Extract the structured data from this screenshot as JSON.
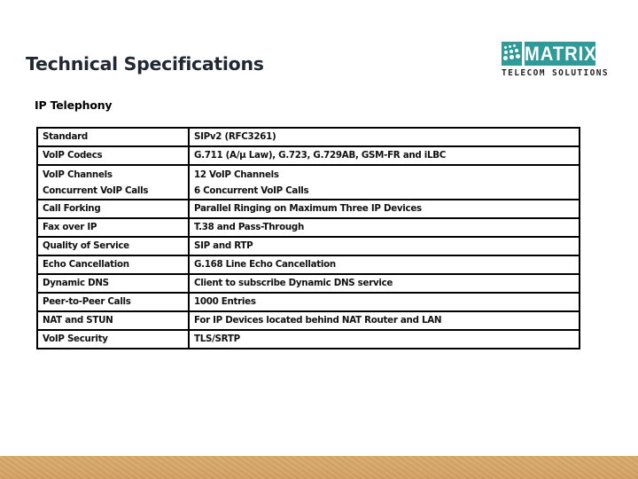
{
  "page": {
    "title": "Technical Specifications",
    "section_title": "IP Telephony"
  },
  "logo": {
    "icon": "matrix-dots-icon",
    "word": "MATRIX",
    "tagline": "TELECOM SOLUTIONS",
    "brand_color": "#2e9a9a"
  },
  "table": {
    "rows": [
      {
        "label": [
          "Standard"
        ],
        "value": [
          "SIPv2 (RFC3261)"
        ]
      },
      {
        "label": [
          "VoIP Codecs"
        ],
        "value": [
          "G.711 (A/µ Law), G.723, G.729AB, GSM-FR and iLBC"
        ]
      },
      {
        "label": [
          "VoIP Channels",
          "Concurrent VoIP Calls"
        ],
        "value": [
          "12 VoIP Channels",
          "6 Concurrent VoIP Calls"
        ]
      },
      {
        "label": [
          "Call Forking"
        ],
        "value": [
          "Parallel Ringing on Maximum Three IP Devices"
        ]
      },
      {
        "label": [
          "Fax over IP"
        ],
        "value": [
          "T.38 and Pass-Through"
        ]
      },
      {
        "label": [
          "Quality of Service"
        ],
        "value": [
          "SIP and RTP"
        ]
      },
      {
        "label": [
          "Echo Cancellation"
        ],
        "value": [
          "G.168 Line Echo Cancellation"
        ]
      },
      {
        "label": [
          "Dynamic DNS"
        ],
        "value": [
          "Client to subscribe Dynamic DNS service"
        ]
      },
      {
        "label": [
          "Peer-to-Peer Calls"
        ],
        "value": [
          "1000 Entries"
        ]
      },
      {
        "label": [
          "NAT and STUN"
        ],
        "value": [
          "For IP Devices located behind NAT Router and LAN"
        ]
      },
      {
        "label": [
          "VoIP Security"
        ],
        "value": [
          "TLS/SRTP"
        ]
      }
    ]
  },
  "footer": {
    "band_color": "#d7a769"
  }
}
